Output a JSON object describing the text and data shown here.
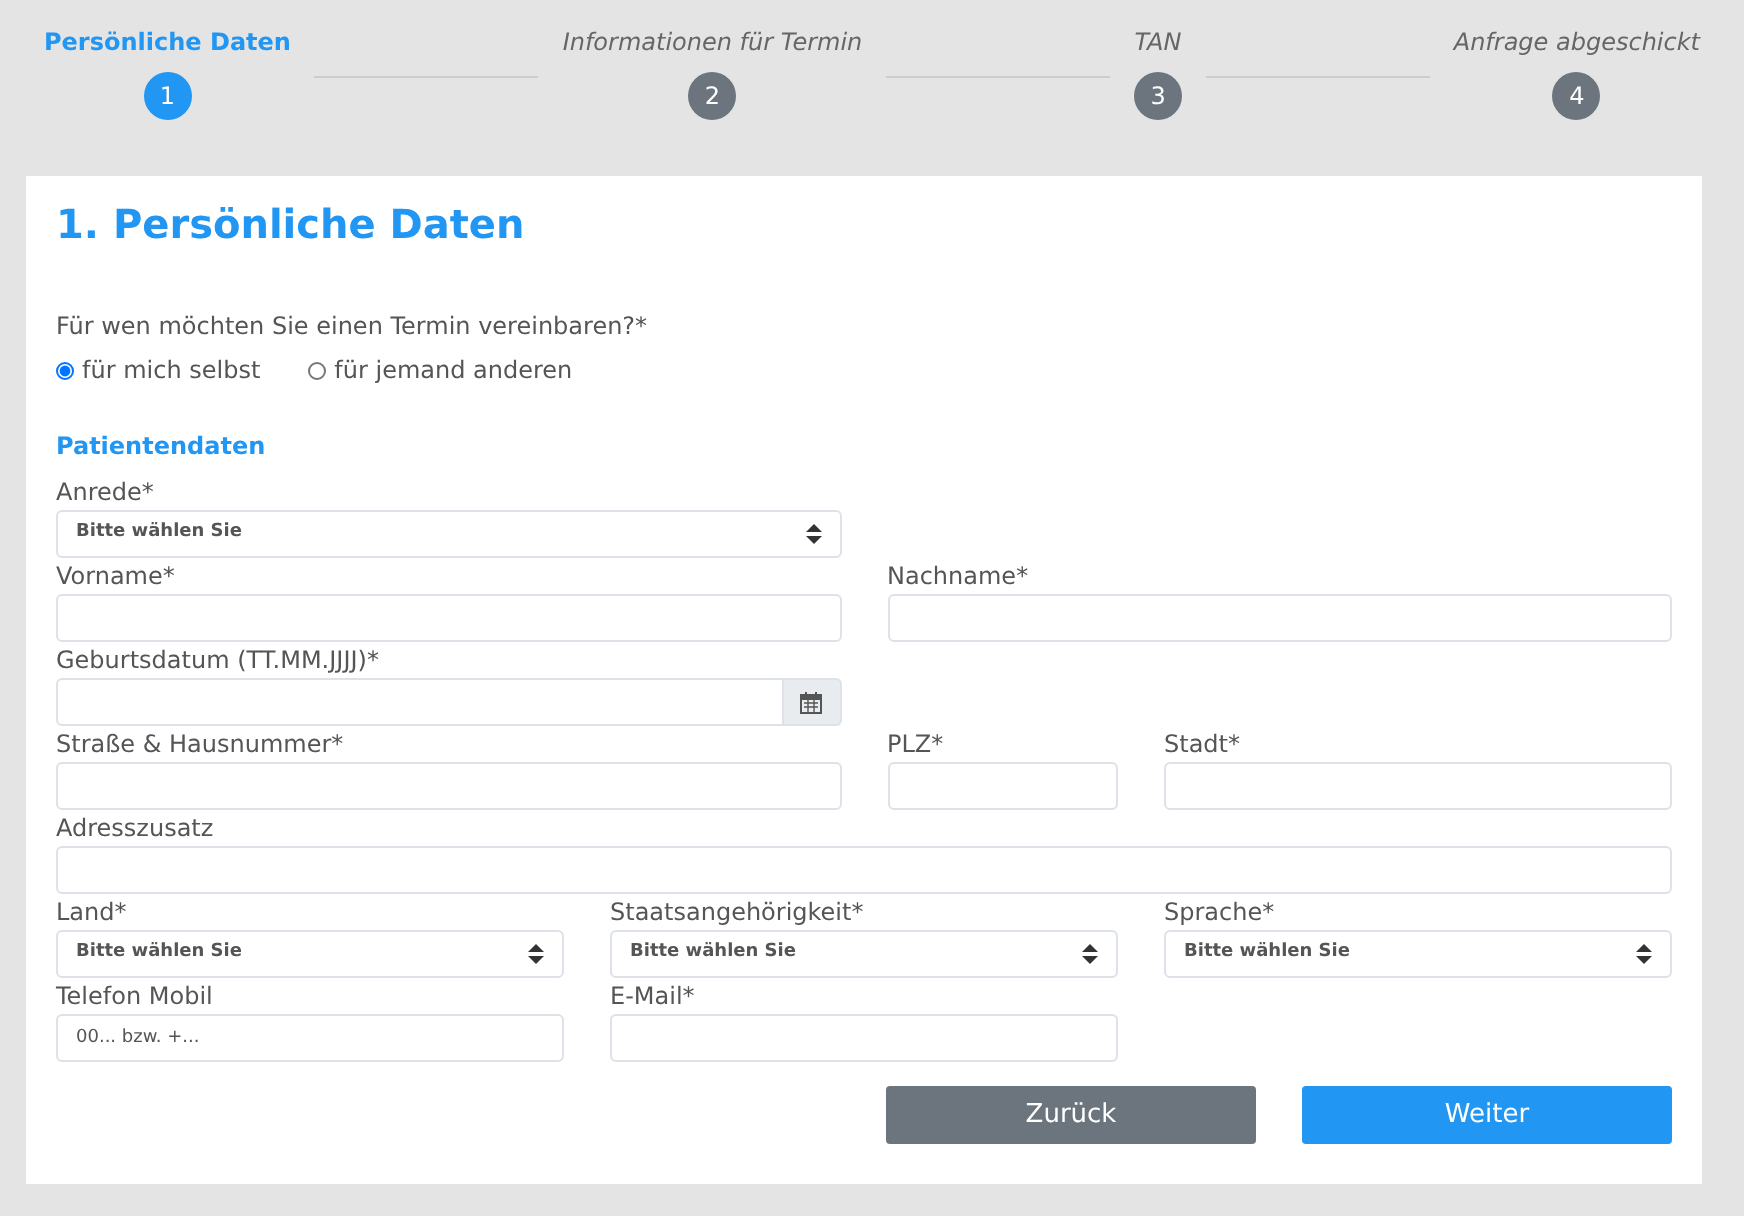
{
  "steps": [
    {
      "number": "1",
      "label": "Persönliche Daten",
      "selected": true
    },
    {
      "number": "2",
      "label": "Informationen für Termin",
      "selected": false
    },
    {
      "number": "3",
      "label": "TAN",
      "selected": false
    },
    {
      "number": "4",
      "label": "Anfrage abgeschickt",
      "selected": false
    }
  ],
  "title": "1. Persönliche Daten",
  "question": "Für wen möchten Sie einen Termin vereinbaren?*",
  "options": [
    {
      "label": "für mich selbst",
      "selected": true
    },
    {
      "label": "für jemand anderen",
      "selected": false
    }
  ],
  "section_title": "Patientendaten",
  "rows": [
    [
      {
        "kind": "select",
        "label": "Anrede*",
        "value": "Bitte wählen Sie"
      }
    ],
    [
      {
        "kind": "text",
        "label": "Vorname*"
      },
      {
        "kind": "text",
        "label": "Nachname*"
      }
    ],
    [
      {
        "kind": "date",
        "label": "Geburtsdatum (TT.MM.JJJJ)*"
      }
    ],
    [
      {
        "kind": "text",
        "label": "Straße & Hausnummer*"
      },
      {
        "kind": "text",
        "label": "PLZ*"
      },
      {
        "kind": "text",
        "label": "Stadt*"
      }
    ],
    [
      {
        "kind": "text",
        "label": "Adresszusatz"
      }
    ],
    [
      {
        "kind": "select",
        "label": "Land*",
        "value": "Bitte wählen Sie"
      },
      {
        "kind": "select",
        "label": "Staatsangehörigkeit*",
        "value": "Bitte wählen Sie"
      },
      {
        "kind": "select",
        "label": "Sprache*",
        "value": "Bitte wählen Sie"
      }
    ],
    [
      {
        "kind": "text",
        "label": "Telefon Mobil",
        "placeholder": "00... bzw. +..."
      },
      {
        "kind": "text",
        "label": "E-Mail*"
      }
    ]
  ],
  "buttons": [
    {
      "kind": "back",
      "label": "Zurück"
    },
    {
      "kind": "next",
      "label": "Weiter"
    }
  ]
}
